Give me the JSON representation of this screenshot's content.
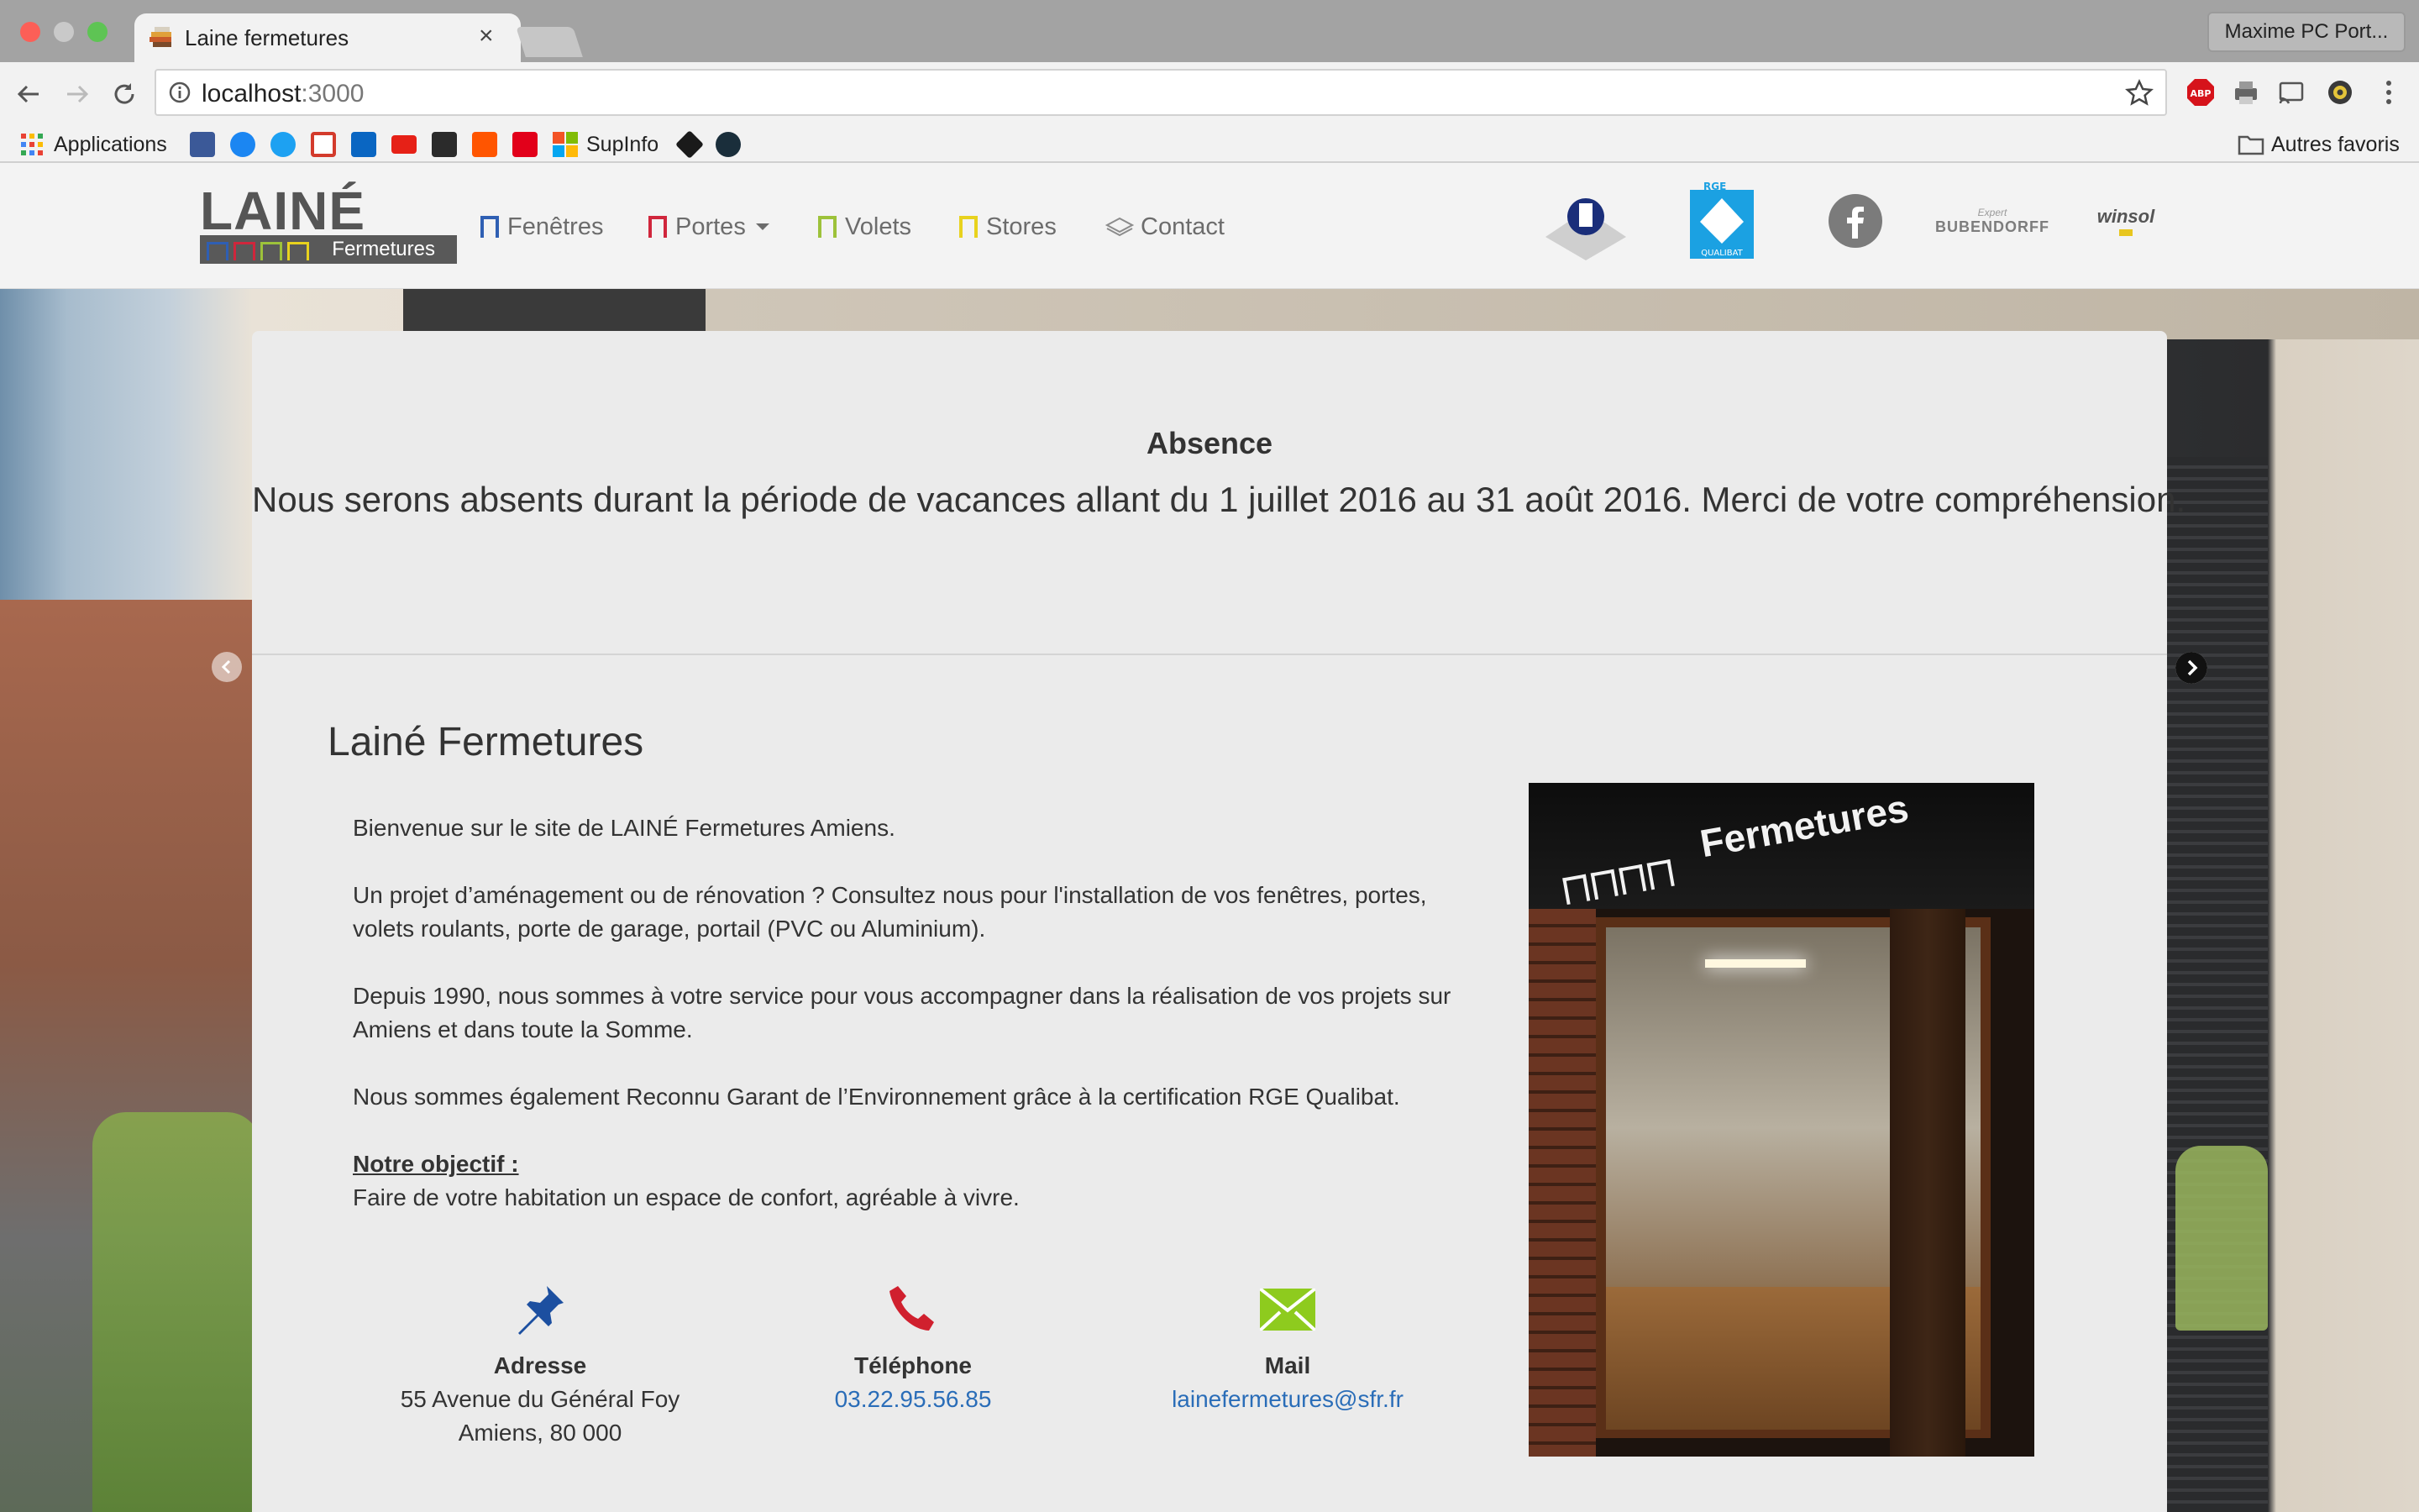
{
  "browser": {
    "tab_title": "Laine fermetures",
    "profile_label": "Maxime PC Port...",
    "url_host": "localhost",
    "url_port": ":3000"
  },
  "bookmarks": {
    "apps_label": "Applications",
    "supinfo_label": "SupInfo",
    "other_label": "Autres favoris",
    "icons": [
      "facebook-icon",
      "messenger-icon",
      "twitter-icon",
      "gmail-icon",
      "linkedin-icon",
      "youtube-icon",
      "dashboard-icon",
      "soundcloud-icon",
      "sfr-icon",
      "microsoft-icon",
      "squarespace-icon",
      "scribd-icon"
    ]
  },
  "header": {
    "logo_word": "LAINÉ",
    "logo_sub": "Fermetures",
    "menu": [
      {
        "label": "Fenêtres",
        "color": "#2f5fb3"
      },
      {
        "label": "Portes",
        "color": "#d0263c"
      },
      {
        "label": "Volets",
        "color": "#9dc23a"
      },
      {
        "label": "Stores",
        "color": "#e8d21e"
      },
      {
        "label": "Contact",
        "color": "#8c8c8c"
      }
    ],
    "partners": {
      "rge_label": "RGE",
      "qualibat_label": "QUALIBAT",
      "bubendorff_label": "BUBENDORFF",
      "winsol_label": "winsol"
    }
  },
  "alert": {
    "title": "Absence",
    "text": "Nous serons absents durant la période de vacances allant du 1 juillet 2016 au 31 août 2016. Merci de votre compréhension."
  },
  "content": {
    "title": "Lainé Fermetures",
    "p1": "Bienvenue sur le site de LAINÉ Fermetures Amiens.",
    "p2": "Un projet d’aménagement ou de rénovation ? Consultez nous pour l'installation de vos fenêtres, portes, volets roulants, porte de garage, portail (PVC ou Aluminium).",
    "p3": "Depuis 1990, nous sommes à votre service pour vous accompagner dans la réalisation de vos projets sur Amiens et dans toute la Somme.",
    "p4": "Nous sommes également Reconnu Garant de l’Environnement grâce à la certification RGE Qualibat.",
    "objectif_title": "Notre objectif :",
    "objectif_text": "Faire de votre habitation un espace de confort, agréable à vivre."
  },
  "contact": {
    "address_label": "Adresse",
    "address_line1": "55 Avenue du Général Foy",
    "address_line2": "Amiens, 80 000",
    "phone_label": "Téléphone",
    "phone_value": "03.22.95.56.85",
    "mail_label": "Mail",
    "mail_value": "lainefermetures@sfr.fr"
  },
  "shop_photo": {
    "sign_text": "Fermetures"
  },
  "colors": {
    "link": "#2a6db8",
    "pin": "#1c4fa0",
    "phone": "#d0202e",
    "mail": "#8ecb1e"
  }
}
